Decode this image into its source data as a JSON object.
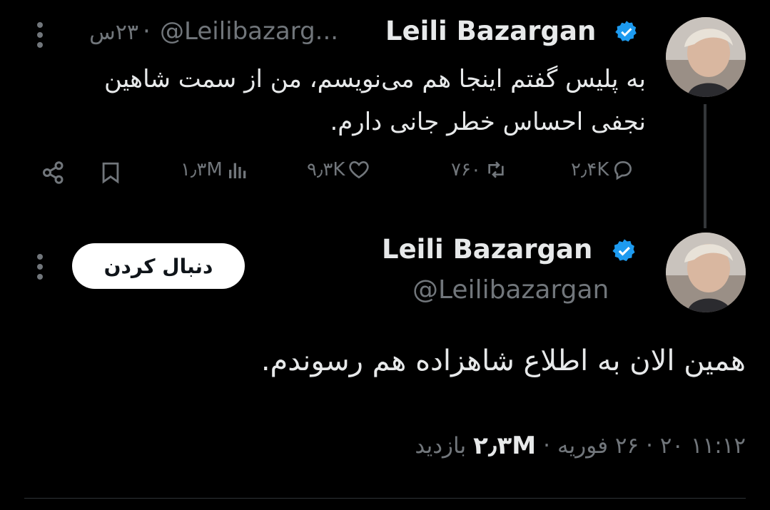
{
  "reply_tweet": {
    "author_name": "Leili Bazargan",
    "handle": "@Leilibazarg...",
    "separator": "·",
    "time": "۲۳س",
    "text_line1": "به پلیس گفتم اینجا هم می‌نویسم، من از سمت شاهین",
    "text_line2": "نجفی احساس خطر جانی دارم.",
    "replies": "۲٫۴K",
    "reposts": "۷۶۰",
    "likes": "۹٫۳K",
    "views": "۱٫۳M",
    "icons": [
      "more-icon",
      "verified-badge-icon",
      "reply-icon",
      "repost-icon",
      "like-icon",
      "views-icon",
      "bookmark-icon",
      "share-icon"
    ]
  },
  "main_tweet": {
    "author_name": "Leili Bazargan",
    "handle": "@Leilibazargan",
    "follow_label": "دنبال کردن",
    "text": "همین الان به اطلاع شاهزاده هم رسوندم.",
    "timestamp": "۱۱:۱۲ ۲۰ · ۲۶ فوریه",
    "separator": "·",
    "views_count": "۲٫۳M",
    "views_label": "بازدید",
    "icons": [
      "more-icon",
      "verified-badge-icon"
    ]
  },
  "colors": {
    "background": "#000000",
    "primary_text": "#e7e9ea",
    "muted_text": "#71767b",
    "verified_blue": "#1d9bf0",
    "follow_bg": "#ffffff"
  }
}
